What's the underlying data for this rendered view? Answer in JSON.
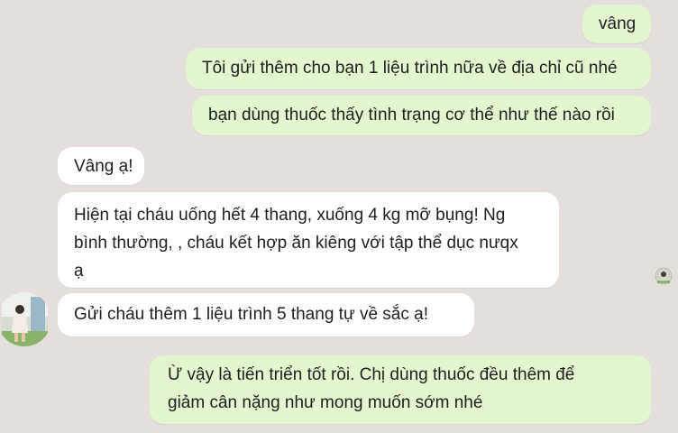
{
  "messages": [
    {
      "side": "outgoing",
      "text": "vâng"
    },
    {
      "side": "outgoing",
      "text": "Tôi gửi thêm cho bạn 1 liệu trình nữa về địa chỉ cũ nhé"
    },
    {
      "side": "outgoing",
      "text": "bạn dùng thuốc thấy tình trạng cơ thể như thế nào rồi"
    },
    {
      "side": "incoming",
      "text": "Vâng ạ!"
    },
    {
      "side": "incoming",
      "text": "Hiện tại cháu uống hết 4 thang, xuống 4 kg mỡ bụng! Ng\nbình thường, , cháu kết hợp ăn kiêng với tập thể dục nưqx\nạ"
    },
    {
      "side": "incoming",
      "text": "Gửi cháu thêm 1 liệu trình 5 thang tự về sắc ạ!"
    },
    {
      "side": "outgoing",
      "text": "Ừ vậy là tiến triển tốt rồi. Chị dùng thuốc đều thêm để\ngiảm cân nặng như mong muốn sớm nhé"
    }
  ],
  "colors": {
    "background": "#e4dfdc",
    "outgoing_bubble": "#e3f6cf",
    "incoming_bubble": "#ffffff",
    "text": "#1f1f1f"
  },
  "icons": {
    "contact_avatar": "contact-avatar-photo",
    "seen_indicator": "seen-avatar-icon"
  }
}
